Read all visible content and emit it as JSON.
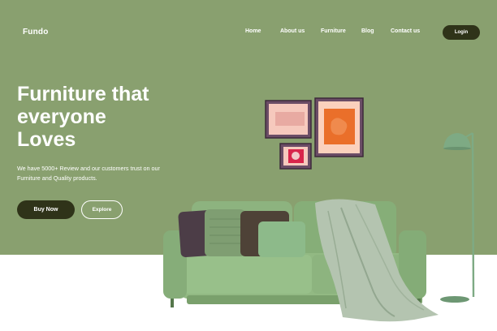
{
  "nav": {
    "logo": "Fundo",
    "links": [
      "Home",
      "About us",
      "Furniture",
      "Blog",
      "Contact us"
    ],
    "login": "Login"
  },
  "hero": {
    "headline": [
      "Furniture that",
      "everyone",
      "Loves"
    ],
    "description": [
      "We have 5000+ Review and our customers trust on our",
      "Furniture and Quality products."
    ],
    "buy_button": "Buy Now",
    "explore_button": "Explore"
  },
  "colors": {
    "hero_background": "#89a06f",
    "dark_button": "#2f3319",
    "sofa": "#8db37f",
    "frame": "#5b3e56",
    "lamp": "#7eaa84"
  },
  "icons": [
    "wall-frame-art",
    "sofa-illustration",
    "floor-lamp-illustration",
    "throw-blanket"
  ]
}
